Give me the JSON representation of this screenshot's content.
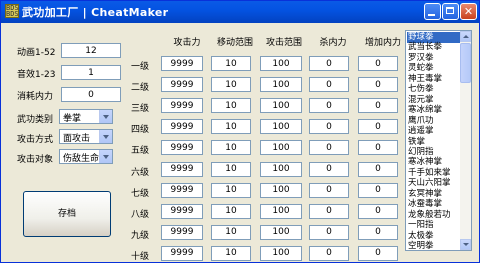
{
  "window": {
    "title": "武功加工厂 | CheatMaker",
    "icon_text": "BDS BDS"
  },
  "left": {
    "fields": [
      {
        "label": "动画1-52",
        "value": "12"
      },
      {
        "label": "音效1-23",
        "value": "1"
      },
      {
        "label": "消耗内力",
        "value": "0"
      }
    ],
    "selects": [
      {
        "label": "武功类别",
        "value": "拳掌"
      },
      {
        "label": "攻击方式",
        "value": "面攻击"
      },
      {
        "label": "攻击对象",
        "value": "伤敌生命"
      }
    ],
    "save_label": "存档"
  },
  "table": {
    "headers": [
      "攻击力",
      "移动范围",
      "攻击范围",
      "杀内力",
      "增加内力"
    ],
    "rows": [
      {
        "label": "一级",
        "values": [
          "9999",
          "10",
          "100",
          "0",
          "0"
        ]
      },
      {
        "label": "二级",
        "values": [
          "9999",
          "10",
          "100",
          "0",
          "0"
        ]
      },
      {
        "label": "三级",
        "values": [
          "9999",
          "10",
          "100",
          "0",
          "0"
        ]
      },
      {
        "label": "四级",
        "values": [
          "9999",
          "10",
          "100",
          "0",
          "0"
        ]
      },
      {
        "label": "五级",
        "values": [
          "9999",
          "10",
          "100",
          "0",
          "0"
        ]
      },
      {
        "label": "六级",
        "values": [
          "9999",
          "10",
          "100",
          "0",
          "0"
        ]
      },
      {
        "label": "七级",
        "values": [
          "9999",
          "10",
          "100",
          "0",
          "0"
        ]
      },
      {
        "label": "八级",
        "values": [
          "9999",
          "10",
          "100",
          "0",
          "0"
        ]
      },
      {
        "label": "九级",
        "values": [
          "9999",
          "10",
          "100",
          "0",
          "0"
        ]
      },
      {
        "label": "十级",
        "values": [
          "9999",
          "10",
          "100",
          "0",
          "0"
        ]
      }
    ]
  },
  "skills_list": {
    "items": [
      "野球拳",
      "武当长拳",
      "罗汉拳",
      "灵蛇拳",
      "神王毒掌",
      "七伤拳",
      "混元掌",
      "寒冰绵掌",
      "鹰爪功",
      "逍遥掌",
      "铁掌",
      "幻阴指",
      "寒冰神掌",
      "千手如来掌",
      "天山六阳掌",
      "玄冥神掌",
      "冰蚕毒掌",
      "龙象般若功",
      "一阳指",
      "太极拳",
      "空明拳"
    ],
    "selected_index": 0
  }
}
